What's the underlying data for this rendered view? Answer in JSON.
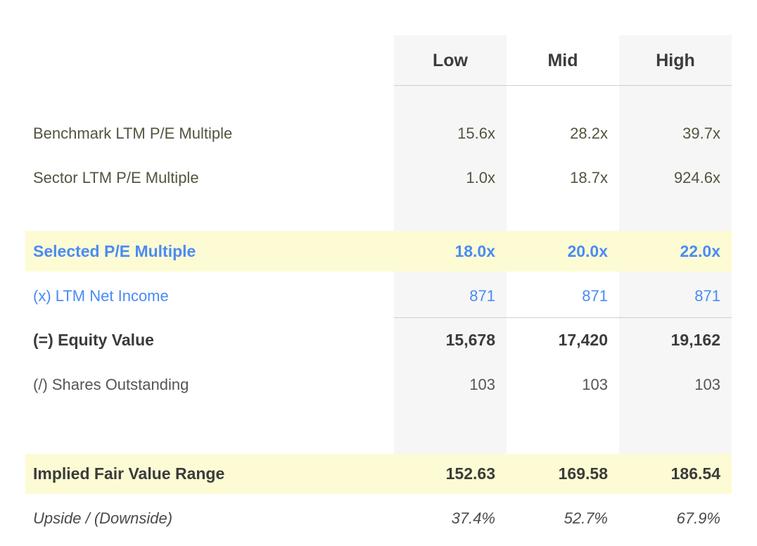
{
  "table": {
    "columns": [
      {
        "key": "low",
        "label": "Low"
      },
      {
        "key": "mid",
        "label": "Mid"
      },
      {
        "key": "high",
        "label": "High"
      }
    ],
    "rows": [
      {
        "name": "benchmark-ltm-pe-multiple",
        "label": "Benchmark LTM P/E Multiple",
        "low": "15.6x",
        "mid": "28.2x",
        "high": "39.7x",
        "style": "data"
      },
      {
        "name": "sector-ltm-pe-multiple",
        "label": "Sector LTM P/E Multiple",
        "low": "1.0x",
        "mid": "18.7x",
        "high": "924.6x",
        "style": "data"
      },
      {
        "name": "selected-pe-multiple",
        "label": "Selected P/E Multiple",
        "low": "18.0x",
        "mid": "20.0x",
        "high": "22.0x",
        "style": "accent-bold-highlight"
      },
      {
        "name": "ltm-net-income",
        "label": "(x) LTM Net Income",
        "low": "871",
        "mid": "871",
        "high": "871",
        "style": "accent"
      },
      {
        "name": "equity-value",
        "label": "(=) Equity Value",
        "low": "15,678",
        "mid": "17,420",
        "high": "19,162",
        "style": "strong"
      },
      {
        "name": "shares-outstanding",
        "label": "(/) Shares Outstanding",
        "low": "103",
        "mid": "103",
        "high": "103",
        "style": "plain"
      },
      {
        "name": "implied-fair-value-range",
        "label": "Implied Fair Value Range",
        "low": "152.63",
        "mid": "169.58",
        "high": "186.54",
        "style": "strong-highlight"
      },
      {
        "name": "upside-downside",
        "label": "Upside / (Downside)",
        "low": "37.4%",
        "mid": "52.7%",
        "high": "67.9%",
        "style": "italic"
      }
    ]
  },
  "colors": {
    "accent_blue": "#4a8bf5",
    "highlight_yellow": "#fdfbd4",
    "column_shade": "#f6f6f6",
    "label_olive": "#55543f",
    "strong_text": "#3b3b3b",
    "rule": "#cfcfcf"
  }
}
